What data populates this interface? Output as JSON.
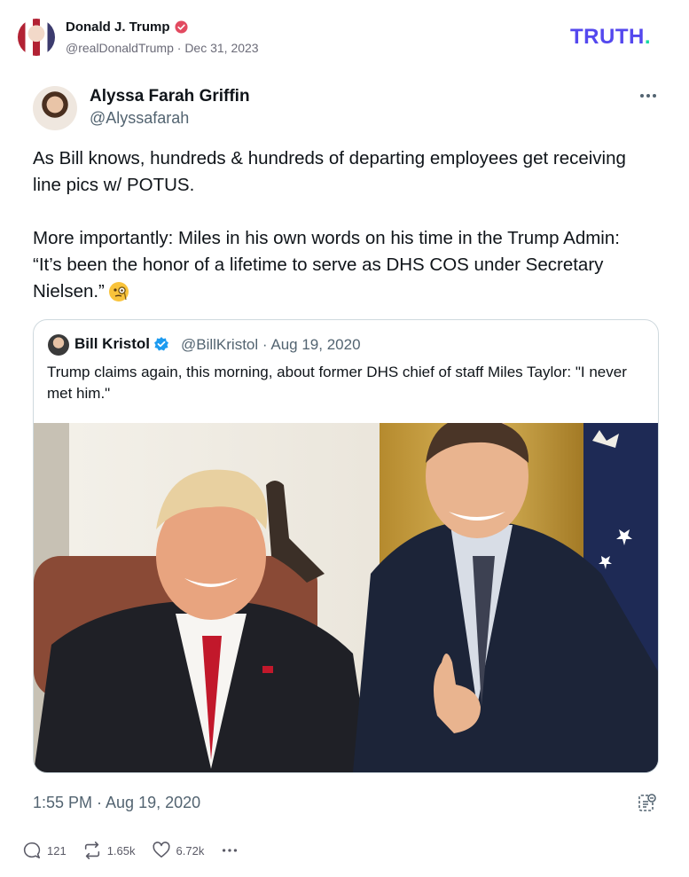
{
  "post": {
    "author_name": "Donald J. Trump",
    "author_handle": "@realDonaldTrump",
    "date_separator": "·",
    "date": "Dec 31, 2023",
    "platform_logo_text": "TRUTH",
    "platform_logo_dot": ".",
    "verified_color": "#e24a60"
  },
  "tweet": {
    "author_name": "Alyssa Farah Griffin",
    "author_handle": "@Alyssafarah",
    "text_main": "As Bill knows, hundreds & hundreds of departing employees get receiving line pics w/ POTUS.\n\nMore importantly: Miles in his own words on his time in the Trump Admin: “It’s been the honor of a lifetime to serve as DHS COS under Secretary Nielsen.”",
    "emoji": "face-with-monocle-icon",
    "timestamp": "1:55 PM · Aug 19, 2020"
  },
  "quoted": {
    "author_name": "Bill Kristol",
    "author_handle": "@BillKristol",
    "separator": "·",
    "date": "Aug 19, 2020",
    "text": "Trump claims again, this morning, about former DHS chief of staff Miles Taylor: \"I never met him.\"",
    "verified_color": "#1d9bf0"
  },
  "actions": {
    "replies": "121",
    "reposts": "1.65k",
    "likes": "6.72k"
  }
}
